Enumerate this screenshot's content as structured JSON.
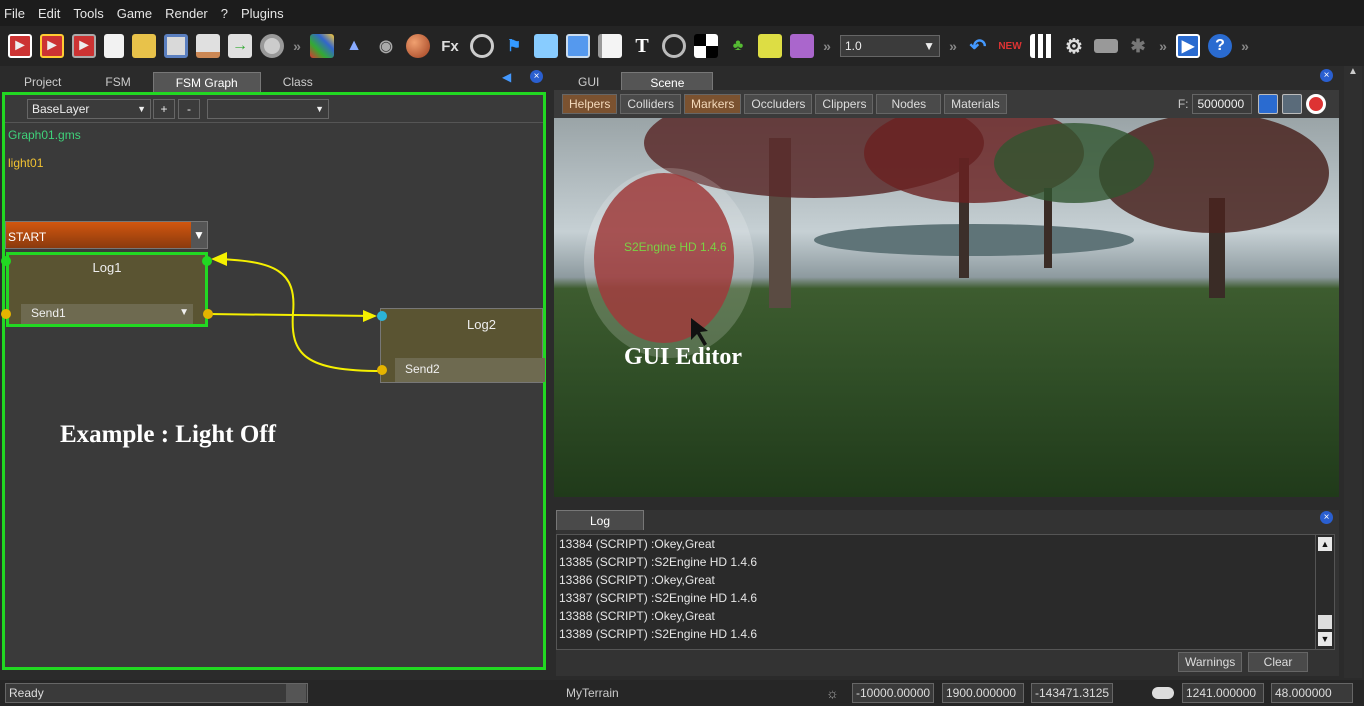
{
  "menu": [
    "File",
    "Edit",
    "Tools",
    "Game",
    "Render",
    "?",
    "Plugins"
  ],
  "toolbar": {
    "icons": [
      "new-scene-icon",
      "open-scene-icon",
      "save-scene-icon",
      "new-file-icon",
      "open-folder-icon",
      "save-icon",
      "export-icon",
      "import-icon",
      "disc-icon",
      "cube-icon",
      "terrain-icon",
      "sculpt-icon",
      "sphere-icon",
      "fx-icon",
      "wheel-icon",
      "flag-icon",
      "document-icon",
      "window-icon",
      "note-icon",
      "text-icon",
      "gauge-icon",
      "checker-icon",
      "tree-icon",
      "page-icon",
      "purple-doc-icon"
    ],
    "fx_label": "Fx",
    "text_label": "T",
    "zoom_value": "1.0",
    "right_icons": [
      "undo-icon",
      "new-icon",
      "grid-icon",
      "settings-icon",
      "keyboard-icon",
      "sun-icon",
      "play-icon",
      "help-icon"
    ]
  },
  "left_tabs": [
    "Project",
    "FSM",
    "FSM Graph",
    "Class"
  ],
  "right_tabs": [
    "GUI",
    "Scene"
  ],
  "fsm": {
    "layer": "BaseLayer",
    "add_label": "+",
    "remove_label": "-",
    "graph_file": "Graph01.gms",
    "object_name": "light01",
    "start_label": "START",
    "node1_title": "Log1",
    "node1_send": "Send1",
    "node2_title": "Log2",
    "node2_send": "Send2",
    "annotation": "Example : Light Off"
  },
  "scene": {
    "buttons": [
      "Helpers",
      "Colliders",
      "Markers",
      "Occluders",
      "Clippers",
      "Nodes",
      "Materials"
    ],
    "active_buttons": [
      "Helpers",
      "Markers"
    ],
    "f_label": "F:",
    "f_value": "5000000",
    "overlay_text": "S2Engine HD 1.4.6",
    "gui_editor_label": "GUI Editor"
  },
  "log": {
    "tab": "Log",
    "lines": [
      "13384 (SCRIPT) :Okey,Great",
      "13385 (SCRIPT) :S2Engine HD 1.4.6",
      "13386 (SCRIPT) :Okey,Great",
      "13387 (SCRIPT) :S2Engine HD 1.4.6",
      "13388 (SCRIPT) :Okey,Great",
      "13389 (SCRIPT) :S2Engine HD 1.4.6"
    ],
    "warnings_label": "Warnings",
    "clear_label": "Clear"
  },
  "status": {
    "ready": "Ready",
    "terrain": "MyTerrain",
    "x": "-10000.00000",
    "y": "1900.000000",
    "z": "-143471.3125",
    "v1": "1241.000000",
    "v2": "48.000000"
  },
  "colors": {
    "highlight": "#22d822",
    "connector": "#f5f000",
    "accent": "#7b5230"
  }
}
